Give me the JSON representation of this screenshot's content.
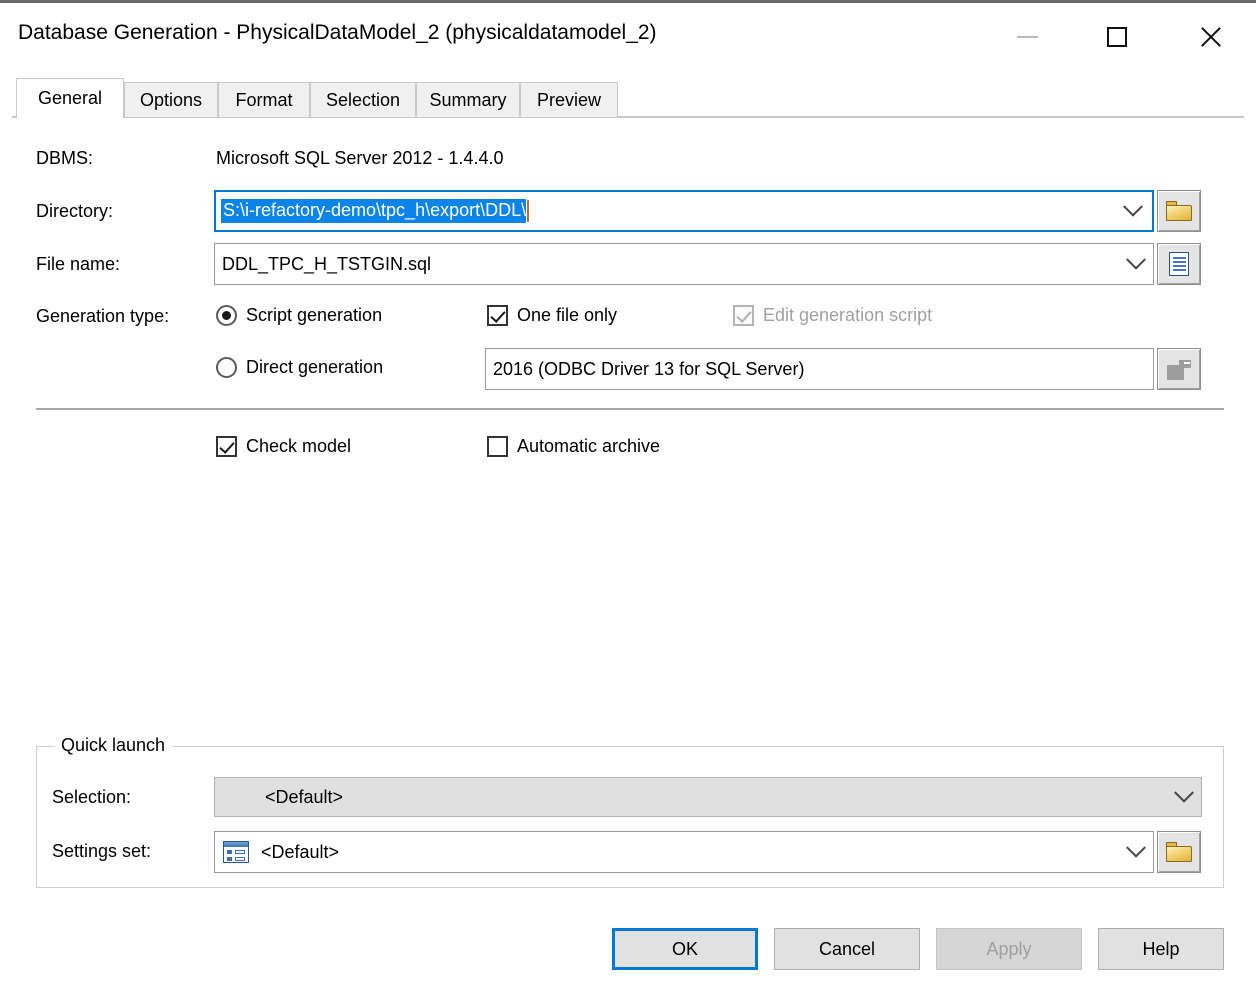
{
  "window": {
    "title": "Database Generation - PhysicalDataModel_2 (physicaldatamodel_2)",
    "minimize_label": "Minimize",
    "maximize_label": "Maximize",
    "close_label": "Close",
    "accent_color": "#0078d7",
    "selection_color": "#0a84e8"
  },
  "tabs": [
    {
      "label": "General",
      "active": true
    },
    {
      "label": "Options",
      "active": false
    },
    {
      "label": "Format",
      "active": false
    },
    {
      "label": "Selection",
      "active": false
    },
    {
      "label": "Summary",
      "active": false
    },
    {
      "label": "Preview",
      "active": false
    }
  ],
  "general": {
    "dbms_label": "DBMS:",
    "dbms_value": "Microsoft SQL Server 2012 - 1.4.4.0",
    "directory_label": "Directory:",
    "directory_value": "S:\\i-refactory-demo\\tpc_h\\export\\DDL\\",
    "directory_browse_icon": "folder-icon",
    "filename_label": "File name:",
    "filename_value": "DDL_TPC_H_TSTGIN.sql",
    "filename_browse_icon": "document-icon",
    "generation_type_label": "Generation type:",
    "script_generation_label": "Script generation",
    "script_generation_selected": true,
    "direct_generation_label": "Direct generation",
    "direct_generation_selected": false,
    "one_file_only_label": "One file only",
    "one_file_only_checked": true,
    "edit_generation_script_label": "Edit generation script",
    "edit_generation_script_checked": true,
    "edit_generation_script_disabled": true,
    "odbc_value": "2016 (ODBC Driver 13 for SQL Server)",
    "odbc_browse_icon": "database-connection-icon",
    "check_model_label": "Check model",
    "check_model_checked": true,
    "automatic_archive_label": "Automatic archive",
    "automatic_archive_checked": false
  },
  "quick_launch": {
    "group_title": "Quick launch",
    "selection_label": "Selection:",
    "selection_value": "<Default>",
    "settings_set_label": "Settings set:",
    "settings_set_value": "<Default>",
    "settings_set_icon": "settings-set-icon",
    "settings_set_browse_icon": "folder-icon"
  },
  "footer": {
    "ok_label": "OK",
    "cancel_label": "Cancel",
    "apply_label": "Apply",
    "apply_disabled": true,
    "help_label": "Help"
  }
}
